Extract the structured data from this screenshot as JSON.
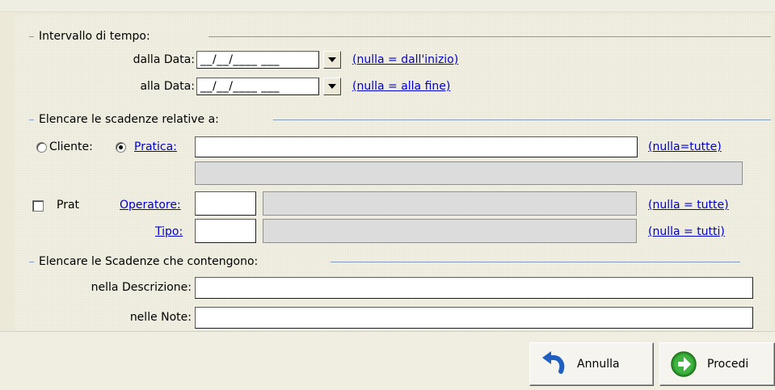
{
  "interval": {
    "title": "Intervallo di tempo:",
    "from_label": "dalla Data:",
    "from_value": "__/__/____ ___",
    "from_hint": "(nulla = dall'inizio)",
    "to_label": "alla Data:",
    "to_value": "__/__/____ ___",
    "to_hint": "(nulla = alla fine)"
  },
  "relative": {
    "title": "Elencare le scadenze relative a:",
    "cliente_label": "Cliente:",
    "pratica_label": "Pratica:",
    "pratica_value": "",
    "pratica_hint": "(nulla=tutte)",
    "pratica_description": "",
    "prat_label": "Prat",
    "operatore_label": "Operatore:",
    "operatore_code": "",
    "operatore_name": "",
    "operatore_hint": "(nulla = tutte)",
    "tipo_label": "Tipo:",
    "tipo_code": "",
    "tipo_name": "",
    "tipo_hint": "(nulla = tutti)"
  },
  "contains": {
    "title": "Elencare le Scadenze che contengono:",
    "descrizione_label": "nella Descrizione:",
    "descrizione_value": "",
    "note_label": "nelle Note:",
    "note_value": ""
  },
  "footer": {
    "cancel_label": "Annulla",
    "proceed_label": "Procedi"
  },
  "colors": {
    "link": "#0000cc",
    "group_line": "#7f9db9",
    "cancel_icon": "#1f5fbf",
    "proceed_icon": "#2e9a2e"
  }
}
